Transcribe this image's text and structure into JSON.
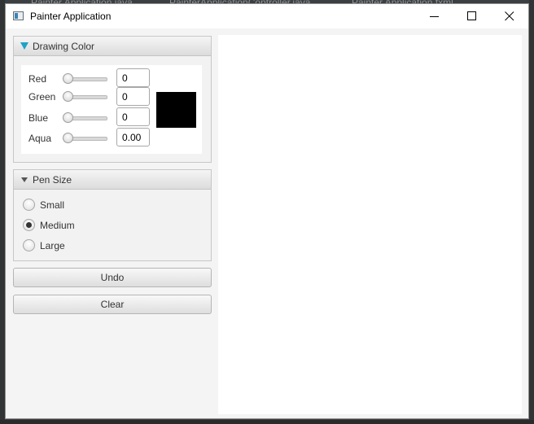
{
  "background_tabs": [
    "Painter Application.java",
    "PainterApplicationController.java",
    "Painter Application.fxml"
  ],
  "window": {
    "title": "Painter Application"
  },
  "drawing_color": {
    "header": "Drawing Color",
    "rows": [
      {
        "label": "Red",
        "value": "0",
        "level": 0
      },
      {
        "label": "Green",
        "value": "0",
        "level": 0
      },
      {
        "label": "Blue",
        "value": "0",
        "level": 0
      },
      {
        "label": "Aqua",
        "value": "0.00",
        "level": 0
      }
    ],
    "preview_color": "#000000"
  },
  "pen_size": {
    "header": "Pen Size",
    "options": [
      {
        "label": "Small",
        "selected": false
      },
      {
        "label": "Medium",
        "selected": true
      },
      {
        "label": "Large",
        "selected": false
      }
    ]
  },
  "buttons": {
    "undo": "Undo",
    "clear": "Clear"
  },
  "colors": {
    "accent": "#1fa2c8",
    "canvas": "#ffffff",
    "chrome_dark": "#3c3f41"
  },
  "icons": {
    "app": "app-window-icon",
    "minimize": "minimize-icon",
    "maximize": "maximize-icon",
    "close": "close-icon",
    "expand": "triangle-down-icon"
  }
}
